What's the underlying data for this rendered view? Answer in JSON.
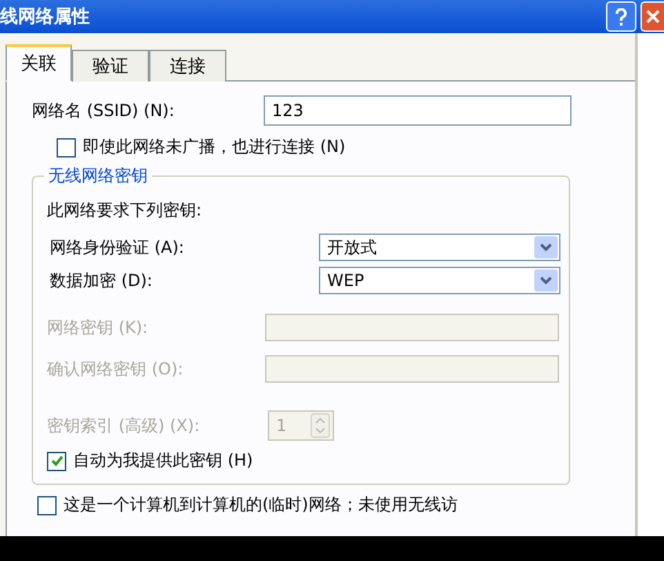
{
  "window": {
    "title": "线网络属性"
  },
  "tabs": [
    {
      "label": "关联",
      "selected": true
    },
    {
      "label": "验证",
      "selected": false
    },
    {
      "label": "连接",
      "selected": false
    }
  ],
  "ssid": {
    "label": "网络名 (SSID) (N):",
    "value": "123"
  },
  "broadcast_checkbox": {
    "label": "即使此网络未广播，也进行连接 (N)",
    "checked": false
  },
  "key_group": {
    "title": "无线网络密钥",
    "intro": "此网络要求下列密钥:",
    "fields": [
      {
        "kind": "select",
        "label": "网络身份验证 (A):",
        "value": "开放式",
        "disabled": false
      },
      {
        "kind": "select",
        "label": "数据加密 (D):",
        "value": "WEP",
        "disabled": false
      },
      {
        "kind": "input",
        "label": "网络密钥 (K):",
        "disabled": true
      },
      {
        "kind": "input",
        "label": "确认网络密钥 (O):",
        "disabled": true
      },
      {
        "kind": "spinner",
        "label": "密钥索引 (高级) (X):",
        "value": "1",
        "disabled": true
      }
    ],
    "auto_checkbox": {
      "label": "自动为我提供此密钥 (H)",
      "checked": true
    }
  },
  "adhoc_checkbox": {
    "label": "这是一个计算机到计算机的(临时)网络；未使用无线访",
    "checked": false
  }
}
